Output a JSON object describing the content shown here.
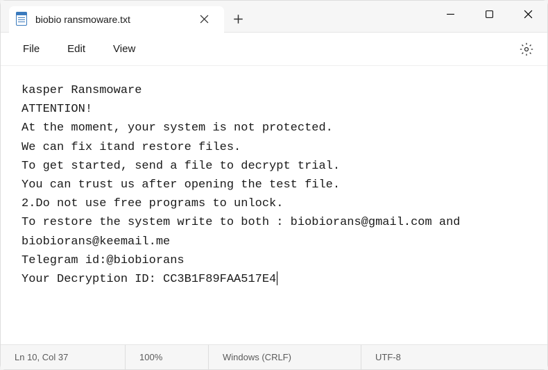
{
  "tab": {
    "title": "biobio ransmoware.txt"
  },
  "menu": {
    "file": "File",
    "edit": "Edit",
    "view": "View"
  },
  "content": {
    "lines": [
      "kasper Ransmoware",
      "ATTENTION!",
      "At the moment, your system is not protected.",
      "We can fix itand restore files.",
      "To get started, send a file to decrypt trial.",
      "You can trust us after opening the test file.",
      "2.Do not use free programs to unlock.",
      "To restore the system write to both : biobiorans@gmail.com and      biobiorans@keemail.me",
      "Telegram id:@biobiorans",
      "Your Decryption ID: CC3B1F89FAA517E4"
    ]
  },
  "status": {
    "position": "Ln 10, Col 37",
    "zoom": "100%",
    "lineending": "Windows (CRLF)",
    "encoding": "UTF-8"
  }
}
